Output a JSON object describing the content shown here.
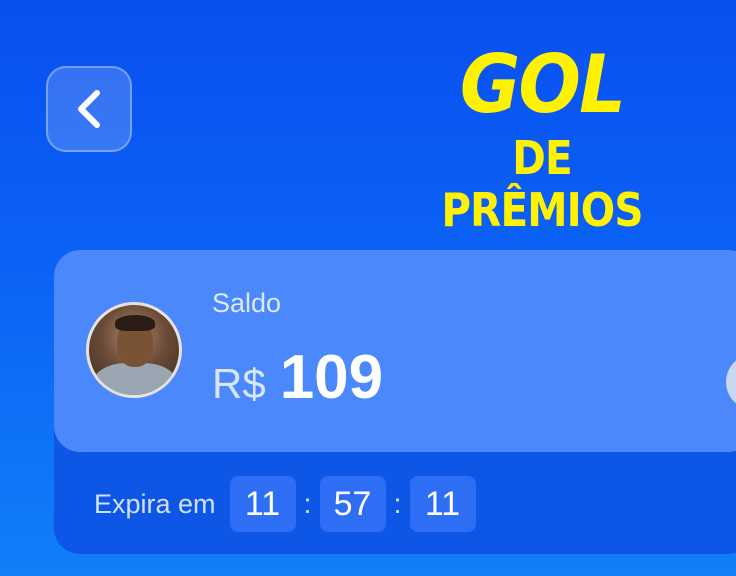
{
  "header": {
    "back_icon": "chevron-left-icon",
    "logo_line1": "GOL",
    "logo_line2": "DE PRÊMIOS",
    "logo_color": "#fff200"
  },
  "balance_card": {
    "saldo_label": "Saldo",
    "currency": "R$",
    "amount": "109",
    "avatar_icon": "user-avatar",
    "expira_label": "Expira em",
    "timer": {
      "hours": "11",
      "minutes": "57",
      "seconds": "11",
      "separator": ":"
    }
  },
  "colors": {
    "background_top": "#0a4ff0",
    "background_bottom": "#117ff8",
    "card_top": "#4a88fb",
    "card_bottom": "#0d56e6"
  }
}
